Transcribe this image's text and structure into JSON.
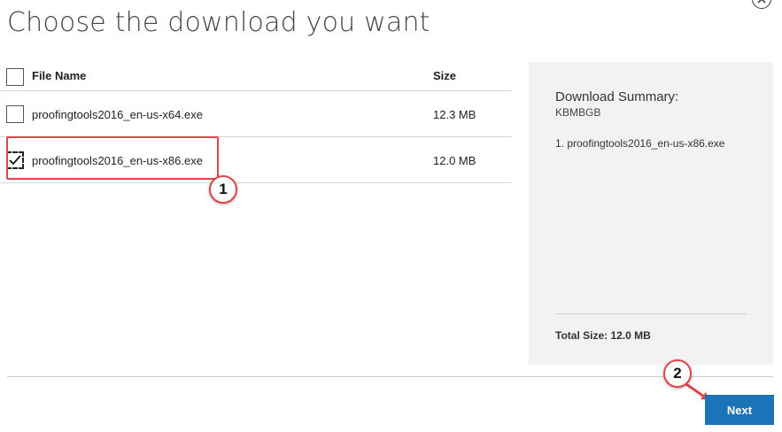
{
  "title": "Choose the download you want",
  "table": {
    "headers": {
      "file_name": "File Name",
      "size": "Size"
    },
    "rows": [
      {
        "file_name": "proofingtools2016_en-us-x64.exe",
        "size": "12.3 MB",
        "checked": false
      },
      {
        "file_name": "proofingtools2016_en-us-x86.exe",
        "size": "12.0 MB",
        "checked": true
      }
    ]
  },
  "summary": {
    "title": "Download Summary:",
    "subtitle": "KBMBGB",
    "items": [
      "1. proofingtools2016_en-us-x86.exe"
    ],
    "total": "Total Size: 12.0 MB"
  },
  "next_label": "Next",
  "annotations": {
    "badge1": "1",
    "badge2": "2"
  },
  "colors": {
    "accent": "#1b73b8",
    "annotation": "#e0454a"
  },
  "icons": {
    "close": "close-icon",
    "check": "checkmark-icon"
  }
}
